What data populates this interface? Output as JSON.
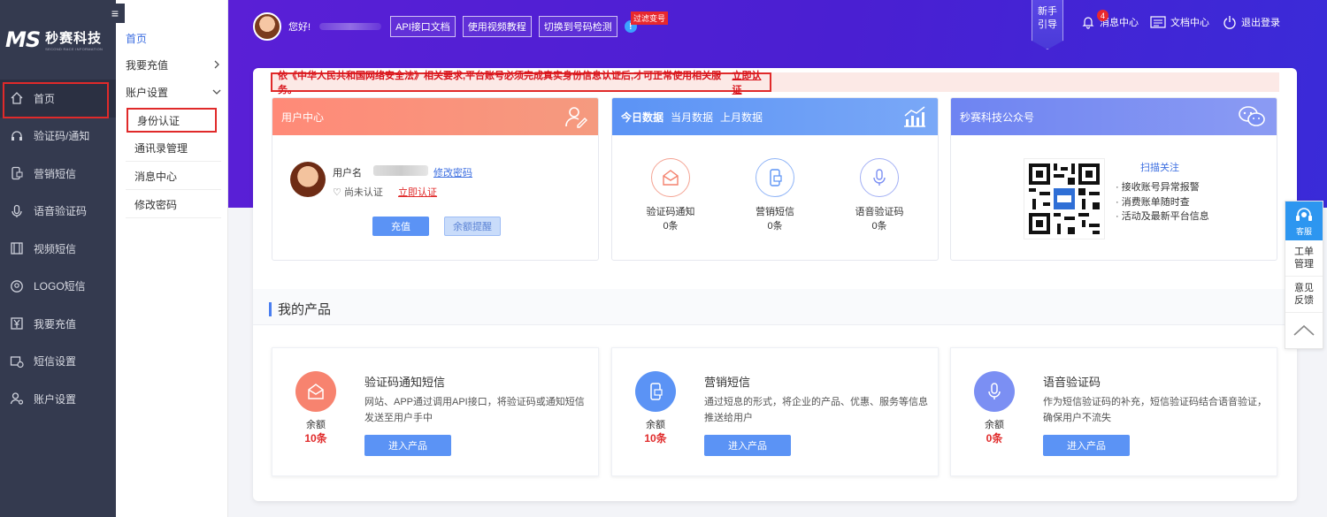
{
  "sidebar": {
    "logo_mark": "MS",
    "logo_cn": "秒赛科技",
    "logo_en": "SECOND RACE INFORMATION",
    "items": [
      {
        "label": "首页",
        "icon": "home-icon"
      },
      {
        "label": "验证码/通知",
        "icon": "headset-icon"
      },
      {
        "label": "营销短信",
        "icon": "phone-doc-icon"
      },
      {
        "label": "语音验证码",
        "icon": "mic-icon"
      },
      {
        "label": "视频短信",
        "icon": "film-icon"
      },
      {
        "label": "LOGO短信",
        "icon": "badge-icon"
      },
      {
        "label": "我要充值",
        "icon": "yen-icon"
      },
      {
        "label": "短信设置",
        "icon": "settings-icon"
      },
      {
        "label": "账户设置",
        "icon": "user-gear-icon"
      }
    ]
  },
  "submenu": {
    "home": "首页",
    "recharge": "我要充值",
    "account": "账户设置",
    "children": [
      "身份认证",
      "通讯录管理",
      "消息中心",
      "修改密码"
    ]
  },
  "header": {
    "greeting": "您好!",
    "buttons": [
      "API接口文档",
      "使用视频教程",
      "切换到号码检测"
    ],
    "info": "!",
    "filter_tag": "过滤变号",
    "guide": [
      "新手",
      "引导"
    ],
    "messages": "消息中心",
    "message_count": "4",
    "docs": "文档中心",
    "logout": "退出登录"
  },
  "notice": {
    "text": "依《中华人民共和国网络安全法》相关要求,平台账号必须完成真实身份信息认证后,才可正常使用相关服务。",
    "link": "立即认证"
  },
  "user_center": {
    "title": "用户中心",
    "username_label": "用户名",
    "change_password": "修改密码",
    "status": "尚未认证",
    "verify": "立即认证",
    "recharge": "充值",
    "balance_alert": "余额提醒"
  },
  "data_panel": {
    "tabs": [
      "今日数据",
      "当月数据",
      "上月数据"
    ],
    "stats": [
      {
        "label": "验证码通知",
        "value": "0条"
      },
      {
        "label": "营销短信",
        "value": "0条"
      },
      {
        "label": "语音验证码",
        "value": "0条"
      }
    ]
  },
  "wechat": {
    "title": "秒赛科技公众号",
    "scan": "扫描关注",
    "bullets": [
      "· 接收账号异常报警",
      "· 消费账单随时查",
      "· 活动及最新平台信息"
    ]
  },
  "products": {
    "heading": "我的产品",
    "items": [
      {
        "name": "验证码通知短信",
        "desc": "网站、APP通过调用API接口，将验证码或通知短信发送至用户手中",
        "balance_label": "余额",
        "balance": "10条",
        "button": "进入产品",
        "color": "#f7836f"
      },
      {
        "name": "营销短信",
        "desc": "通过短息的形式，将企业的产品、优惠、服务等信息推送给用户",
        "balance_label": "余额",
        "balance": "10条",
        "button": "进入产品",
        "color": "#5b93f5"
      },
      {
        "name": "语音验证码",
        "desc": "作为短信验证码的补充，短信验证码结合语音验证，确保用户不流失",
        "balance_label": "余额",
        "balance": "0条",
        "button": "进入产品",
        "color": "#7b8ff3"
      }
    ]
  },
  "float_bar": {
    "service": "客服",
    "ticket": [
      "工单",
      "管理"
    ],
    "feedback": [
      "意见",
      "反馈"
    ]
  }
}
